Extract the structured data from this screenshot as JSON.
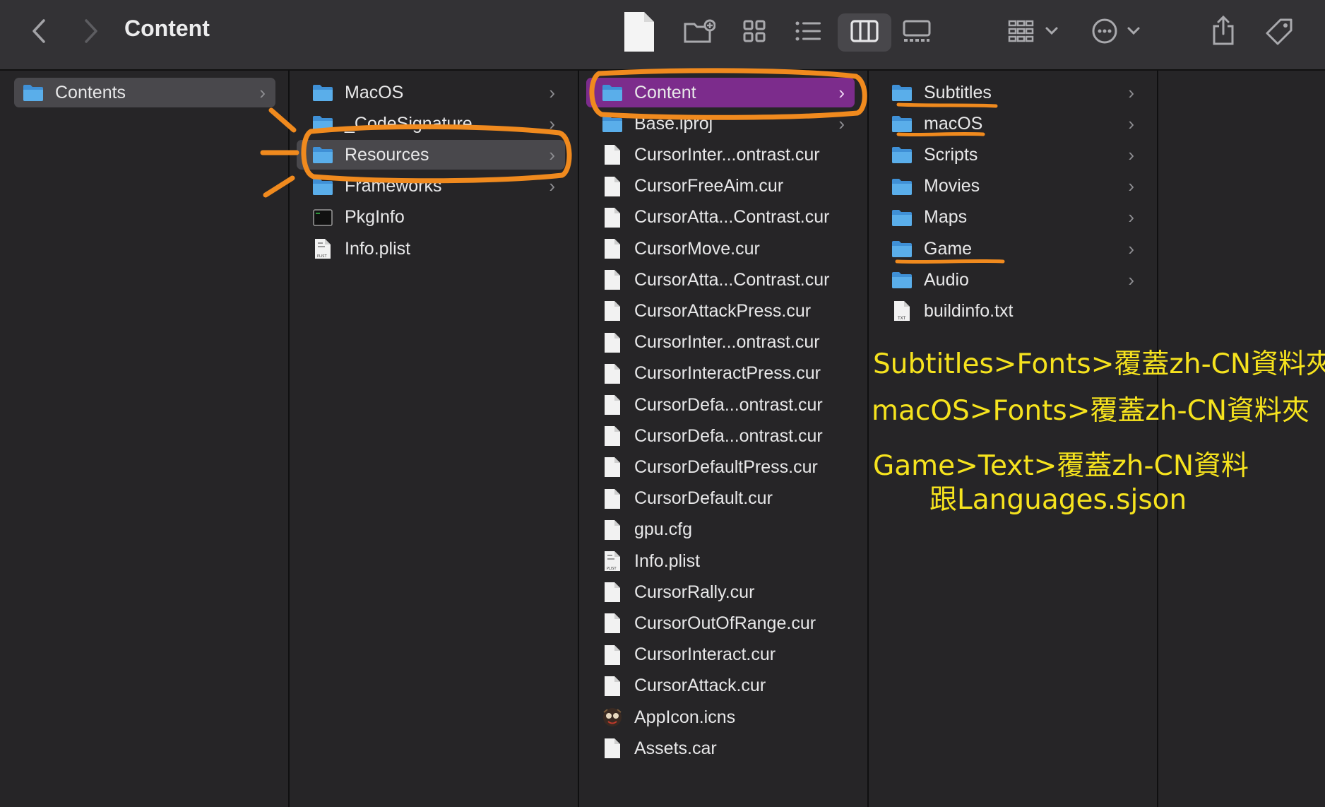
{
  "window": {
    "title": "Content",
    "toolbar_icons": [
      "back-icon",
      "forward-icon",
      "file-icon",
      "new-folder-icon",
      "grid-view-icon",
      "list-view-icon",
      "column-view-icon",
      "gallery-view-icon",
      "group-icon",
      "more-icon",
      "share-icon",
      "tag-icon"
    ]
  },
  "columns": [
    {
      "items": [
        {
          "label": "Contents",
          "kind": "folder",
          "chevron": "›",
          "selected": "grey"
        }
      ]
    },
    {
      "items": [
        {
          "label": "MacOS",
          "kind": "folder",
          "chevron": "›"
        },
        {
          "label": "_CodeSignature",
          "kind": "folder",
          "chevron": "›"
        },
        {
          "label": "Resources",
          "kind": "folder",
          "chevron": "›",
          "selected": "grey"
        },
        {
          "label": "Frameworks",
          "kind": "folder",
          "chevron": "›"
        },
        {
          "label": "PkgInfo",
          "kind": "exec"
        },
        {
          "label": "Info.plist",
          "kind": "plist"
        }
      ]
    },
    {
      "items": [
        {
          "label": "Content",
          "kind": "folder",
          "chevron": "›",
          "selected": "purple"
        },
        {
          "label": "Base.lproj",
          "kind": "folder",
          "chevron": "›"
        },
        {
          "label": "CursorInter...ontrast.cur",
          "kind": "file"
        },
        {
          "label": "CursorFreeAim.cur",
          "kind": "file"
        },
        {
          "label": "CursorAtta...Contrast.cur",
          "kind": "file"
        },
        {
          "label": "CursorMove.cur",
          "kind": "file"
        },
        {
          "label": "CursorAtta...Contrast.cur",
          "kind": "file"
        },
        {
          "label": "CursorAttackPress.cur",
          "kind": "file"
        },
        {
          "label": "CursorInter...ontrast.cur",
          "kind": "file"
        },
        {
          "label": "CursorInteractPress.cur",
          "kind": "file"
        },
        {
          "label": "CursorDefa...ontrast.cur",
          "kind": "file"
        },
        {
          "label": "CursorDefa...ontrast.cur",
          "kind": "file"
        },
        {
          "label": "CursorDefaultPress.cur",
          "kind": "file"
        },
        {
          "label": "CursorDefault.cur",
          "kind": "file"
        },
        {
          "label": "gpu.cfg",
          "kind": "file"
        },
        {
          "label": "Info.plist",
          "kind": "plist"
        },
        {
          "label": "CursorRally.cur",
          "kind": "file"
        },
        {
          "label": "CursorOutOfRange.cur",
          "kind": "file"
        },
        {
          "label": "CursorInteract.cur",
          "kind": "file"
        },
        {
          "label": "CursorAttack.cur",
          "kind": "file"
        },
        {
          "label": "AppIcon.icns",
          "kind": "appicon"
        },
        {
          "label": "Assets.car",
          "kind": "file"
        }
      ]
    },
    {
      "items": [
        {
          "label": "Subtitles",
          "kind": "folder",
          "chevron": "›"
        },
        {
          "label": "macOS",
          "kind": "folder",
          "chevron": "›"
        },
        {
          "label": "Scripts",
          "kind": "folder",
          "chevron": "›"
        },
        {
          "label": "Movies",
          "kind": "folder",
          "chevron": "›"
        },
        {
          "label": "Maps",
          "kind": "folder",
          "chevron": "›"
        },
        {
          "label": "Game",
          "kind": "folder",
          "chevron": "›"
        },
        {
          "label": "Audio",
          "kind": "folder",
          "chevron": "›"
        },
        {
          "label": "buildinfo.txt",
          "kind": "txt"
        }
      ]
    },
    {
      "items": []
    }
  ],
  "annotations": {
    "notes": [
      "Subtitles>Fonts>覆蓋zh-CN資料夾",
      "macOS>Fonts>覆蓋zh-CN資料夾",
      "Game>Text>覆蓋zh-CN資料",
      "跟Languages.sjson"
    ],
    "marker_color": "#f08a1e",
    "note_color": "#f6e31e"
  },
  "colors": {
    "folder": "#5aaeea",
    "selected_grey": "#49484c",
    "selected_purple": "#7c2c8c"
  }
}
